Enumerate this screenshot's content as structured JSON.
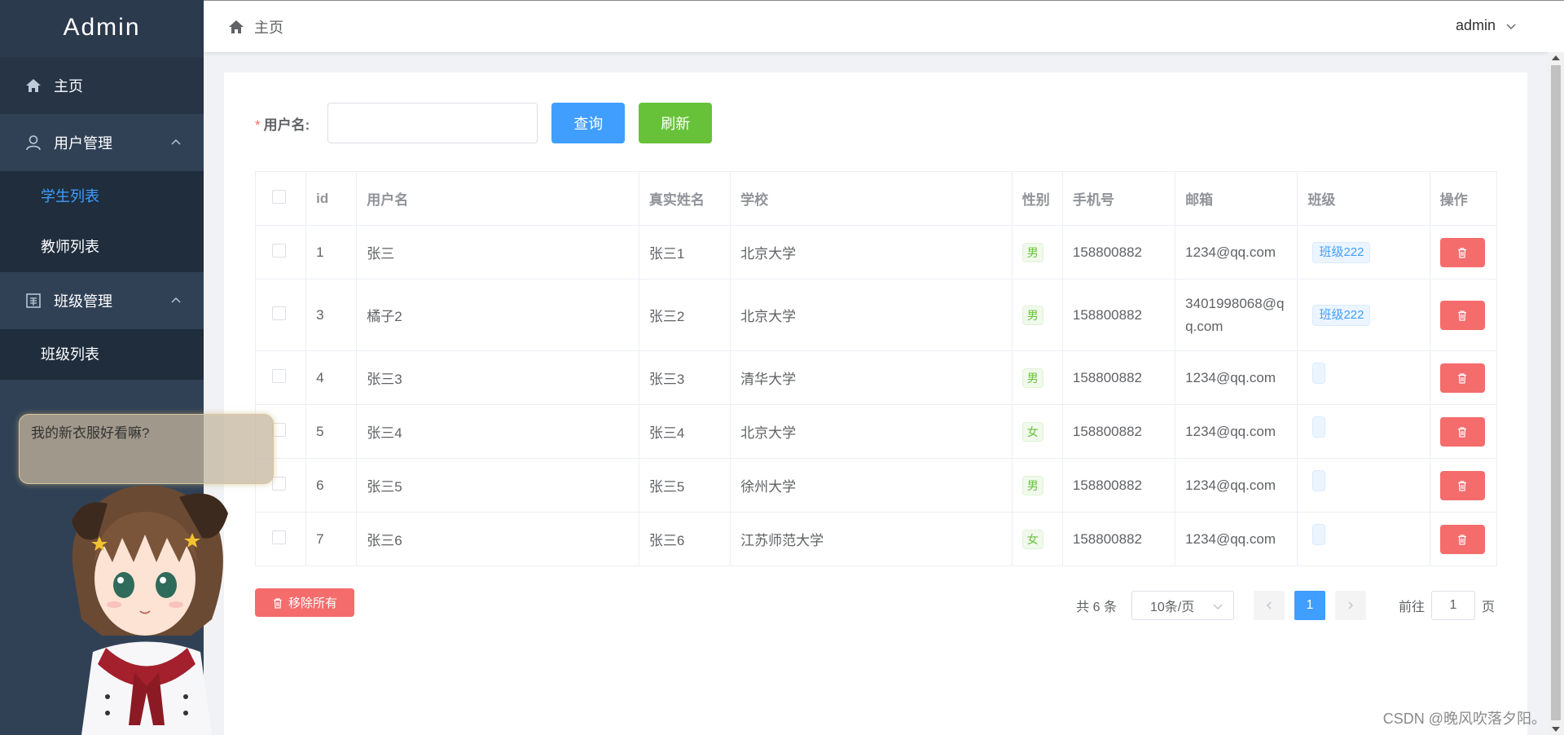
{
  "sidebar": {
    "logo": "Admin",
    "home": "主页",
    "user_group": "用户管理",
    "user_sub": [
      "学生列表",
      "教师列表"
    ],
    "class_group": "班级管理",
    "class_sub": [
      "班级列表"
    ]
  },
  "header": {
    "breadcrumb": "主页",
    "user": "admin"
  },
  "search": {
    "required_mark": "*",
    "label": "用户名:",
    "value": "",
    "query_btn": "查询",
    "refresh_btn": "刷新"
  },
  "table": {
    "columns": [
      "id",
      "用户名",
      "真实姓名",
      "学校",
      "性别",
      "手机号",
      "邮箱",
      "班级",
      "操作"
    ],
    "rows": [
      {
        "id": "1",
        "username": "张三",
        "realname": "张三1",
        "school": "北京大学",
        "gender": "男",
        "phone": "158800882",
        "email": "1234@qq.com",
        "class": "班级222"
      },
      {
        "id": "3",
        "username": "橘子2",
        "realname": "张三2",
        "school": "北京大学",
        "gender": "男",
        "phone": "158800882",
        "email": "3401998068@qq.com",
        "class": "班级222"
      },
      {
        "id": "4",
        "username": "张三3",
        "realname": "张三3",
        "school": "清华大学",
        "gender": "男",
        "phone": "158800882",
        "email": "1234@qq.com",
        "class": ""
      },
      {
        "id": "5",
        "username": "张三4",
        "realname": "张三4",
        "school": "北京大学",
        "gender": "女",
        "phone": "158800882",
        "email": "1234@qq.com",
        "class": ""
      },
      {
        "id": "6",
        "username": "张三5",
        "realname": "张三5",
        "school": "徐州大学",
        "gender": "男",
        "phone": "158800882",
        "email": "1234@qq.com",
        "class": ""
      },
      {
        "id": "7",
        "username": "张三6",
        "realname": "张三6",
        "school": "江苏师范大学",
        "gender": "女",
        "phone": "158800882",
        "email": "1234@qq.com",
        "class": ""
      }
    ]
  },
  "footer": {
    "remove_all": "移除所有",
    "total": "共 6 条",
    "page_size": "10条/页",
    "current_page": "1",
    "goto_prefix": "前往",
    "goto_value": "1",
    "goto_suffix": "页"
  },
  "mascot": {
    "speech": "我的新衣服好看嘛?"
  },
  "watermark": "CSDN @晚风吹落夕阳。",
  "colors": {
    "sidebar_bg": "#304156",
    "accent": "#409eff",
    "success": "#67c23a",
    "danger": "#f56c6c"
  }
}
